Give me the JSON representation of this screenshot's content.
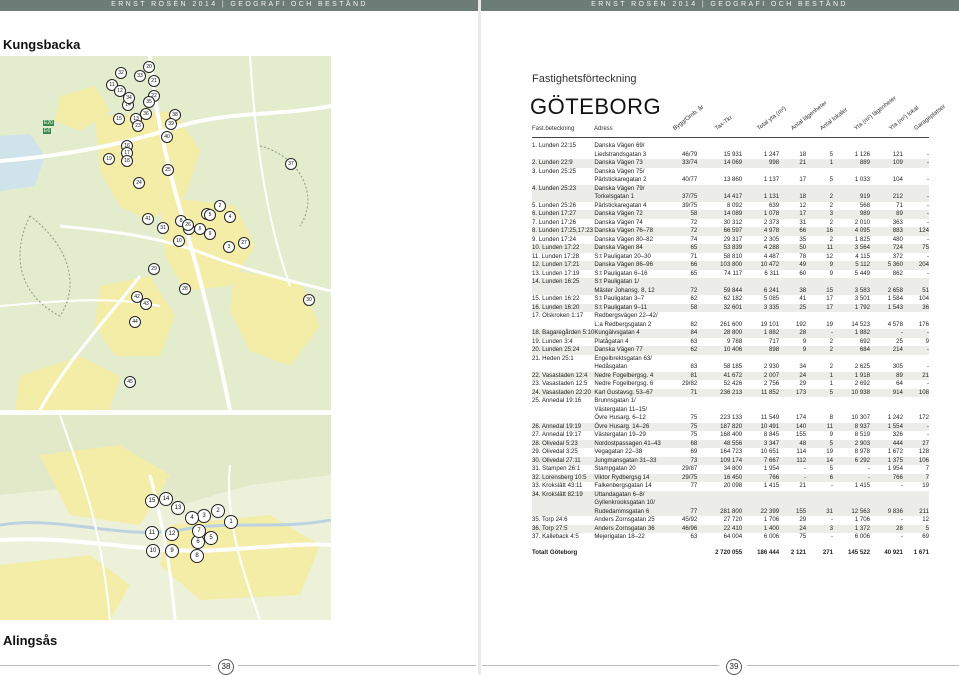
{
  "header": {
    "left": "ERNST ROSÉN 2014 | GEOGRAFI OCH BESTÅND",
    "right": "ERNST ROSÉN 2014 | GEOGRAFI OCH BESTÅND"
  },
  "sections": {
    "top": "Kungsbacka",
    "bottom": "Alingsås"
  },
  "map_top": {
    "road_label_1": "E20",
    "road_label_2": "E6",
    "markers": [
      "1",
      "2",
      "3",
      "4",
      "5",
      "6",
      "7",
      "8",
      "9",
      "10",
      "11",
      "12",
      "13",
      "14",
      "15",
      "16",
      "17",
      "18",
      "19",
      "20",
      "21",
      "22",
      "23",
      "24",
      "25",
      "26",
      "27",
      "28",
      "29",
      "30",
      "31",
      "32",
      "33",
      "34",
      "35",
      "36",
      "37",
      "38",
      "39",
      "40",
      "41",
      "42",
      "43",
      "44",
      "45"
    ]
  },
  "map_bottom": {
    "markers": [
      "1",
      "2",
      "3",
      "4",
      "5",
      "6",
      "7",
      "8",
      "9",
      "10",
      "11",
      "12",
      "13",
      "14",
      "15"
    ]
  },
  "pages": {
    "left": "38",
    "right": "39"
  },
  "document": {
    "subtitle": "Fastighetsförteckning",
    "title": "GÖTEBORG",
    "col_fastbeteckning": "Fast.beteckning",
    "col_adress": "Adress",
    "rotated_headers": [
      "Bygg/Omb. år",
      "Tax-Tkr",
      "Total yta (m²)",
      "Antal lägenheter",
      "Antal lokaler",
      "Yta (m²) lägenheter",
      "Yta (m²) lokal",
      "Garageplatser"
    ]
  },
  "rows": [
    {
      "a": "1. Lunden 22:15",
      "b": "Danska Vägen 69/",
      "c": [
        "",
        "",
        "",
        "",
        "",
        "",
        "",
        ""
      ]
    },
    {
      "a": "",
      "b": "Liedstrandsgatan 3",
      "c": [
        "46/79",
        "15 931",
        "1 247",
        "18",
        "5",
        "1 126",
        "121",
        "-"
      ]
    },
    {
      "a": "2. Lunden 22:9",
      "b": "Danska Vägen 73",
      "c": [
        "33/74",
        "14 069",
        "998",
        "21",
        "1",
        "889",
        "109",
        "-"
      ]
    },
    {
      "a": "3. Lunden 25:25",
      "b": "Danska Vägen 75/",
      "c": [
        "",
        "",
        "",
        "",
        "",
        "",
        "",
        ""
      ]
    },
    {
      "a": "",
      "b": "Pärlstickaregatan 2",
      "c": [
        "40/77",
        "13 860",
        "1 137",
        "17",
        "5",
        "1 033",
        "104",
        "-"
      ]
    },
    {
      "a": "4. Lunden 25:23",
      "b": "Danska Vägen 79/",
      "c": [
        "",
        "",
        "",
        "",
        "",
        "",
        "",
        ""
      ]
    },
    {
      "a": "",
      "b": "Torkelsgatan 1",
      "c": [
        "37/75",
        "14 417",
        "1 131",
        "18",
        "2",
        "919",
        "212",
        "-"
      ]
    },
    {
      "a": "5. Lunden 25:26",
      "b": "Pärlstickaregatan 4",
      "c": [
        "39/75",
        "8 092",
        "639",
        "12",
        "2",
        "568",
        "71",
        "-"
      ]
    },
    {
      "a": "6. Lunden 17:27",
      "b": "Danska Vägen 72",
      "c": [
        "58",
        "14 089",
        "1 078",
        "17",
        "3",
        "989",
        "89",
        "-"
      ]
    },
    {
      "a": "7. Lunden 17:26",
      "b": "Danska Vägen 74",
      "c": [
        "72",
        "30 312",
        "2 373",
        "31",
        "2",
        "2 010",
        "363",
        "-"
      ]
    },
    {
      "a": "8. Lunden 17:25,17:23",
      "b": "Danska Vägen 76–78",
      "c": [
        "72",
        "66 597",
        "4 978",
        "66",
        "16",
        "4 095",
        "883",
        "124"
      ]
    },
    {
      "a": "9. Lunden 17:24",
      "b": "Danska Vägen 80–82",
      "c": [
        "74",
        "29 317",
        "2 305",
        "35",
        "2",
        "1 825",
        "480",
        "-"
      ]
    },
    {
      "a": "10. Lunden 17:22",
      "b": "Danska Vägen 84",
      "c": [
        "65",
        "53 839",
        "4 288",
        "50",
        "11",
        "3 564",
        "724",
        "75"
      ]
    },
    {
      "a": "11. Lunden 17:28",
      "b": "S:t Pauligatan 20–30",
      "c": [
        "71",
        "58 810",
        "4 487",
        "78",
        "12",
        "4 115",
        "372",
        "-"
      ]
    },
    {
      "a": "12. Lunden 17:21",
      "b": "Danska Vägen 86–96",
      "c": [
        "66",
        "103 800",
        "10 472",
        "49",
        "9",
        "5 112",
        "5 360",
        "204"
      ]
    },
    {
      "a": "13. Lunden 17:19",
      "b": "S:t Pauligatan 6–16",
      "c": [
        "65",
        "74 117",
        "6 311",
        "60",
        "9",
        "5 449",
        "862",
        "-"
      ]
    },
    {
      "a": "14. Lunden 16:25",
      "b": "S:t Pauligatan 1/",
      "c": [
        "",
        "",
        "",
        "",
        "",
        "",
        "",
        ""
      ]
    },
    {
      "a": "",
      "b": "Mäster Johansg. 8, 12",
      "c": [
        "72",
        "59 844",
        "6 241",
        "38",
        "15",
        "3 583",
        "2 658",
        "51"
      ]
    },
    {
      "a": "15. Lunden 16:22",
      "b": "S:t Pauligatan 3–7",
      "c": [
        "62",
        "62 182",
        "5 085",
        "41",
        "17",
        "3 501",
        "1 584",
        "104"
      ]
    },
    {
      "a": "16. Lunden 16:20",
      "b": "S:t Pauligatan 9–11",
      "c": [
        "58",
        "32 601",
        "3 335",
        "25",
        "17",
        "1 792",
        "1 543",
        "36"
      ]
    },
    {
      "a": "17. Olskroken 1:17",
      "b": "Redbergsvägen 22–42/",
      "c": [
        "",
        "",
        "",
        "",
        "",
        "",
        "",
        ""
      ]
    },
    {
      "a": "",
      "b": "L:a Redbergsgatan 2",
      "c": [
        "82",
        "261 600",
        "19 101",
        "192",
        "19",
        "14 523",
        "4 578",
        "176"
      ]
    },
    {
      "a": "18. Bagaregården 5:10",
      "b": "Kungälvsgatan 4",
      "c": [
        "84",
        "28 800",
        "1 882",
        "28",
        "-",
        "1 882",
        "-",
        "-"
      ]
    },
    {
      "a": "19. Lunden 3:4",
      "b": "Platågatan 4",
      "c": [
        "63",
        "9 788",
        "717",
        "9",
        "2",
        "692",
        "25",
        "9"
      ]
    },
    {
      "a": "20. Lunden 25:24",
      "b": "Danska Vägen 77",
      "c": [
        "62",
        "10 406",
        "898",
        "9",
        "2",
        "684",
        "214",
        "-"
      ]
    },
    {
      "a": "21. Heden 25:1",
      "b": "Engelbrektsgatan 63/",
      "c": [
        "",
        "",
        "",
        "",
        "",
        "",
        "",
        ""
      ]
    },
    {
      "a": "",
      "b": "Hedåsgatan",
      "c": [
        "83",
        "58 185",
        "2 930",
        "34",
        "2",
        "2 625",
        "305",
        "-"
      ]
    },
    {
      "a": "22. Vasastaden 12:4",
      "b": "Nedre Fogelbergsg. 4",
      "c": [
        "81",
        "41 672",
        "2 007",
        "24",
        "1",
        "1 918",
        "89",
        "21"
      ]
    },
    {
      "a": "23. Vasastaden 12:5",
      "b": "Nedre Fogelbergsg. 6",
      "c": [
        "29/82",
        "52 426",
        "2 756",
        "29",
        "1",
        "2 692",
        "64",
        "-"
      ]
    },
    {
      "a": "24. Vasastaden 22:20",
      "b": "Karl Gustavsg. 53–67",
      "c": [
        "71",
        "236 213",
        "11 852",
        "173",
        "5",
        "10 938",
        "914",
        "108"
      ]
    },
    {
      "a": "25. Annedal 19:16",
      "b": "Brunnsgatan 1/",
      "c": [
        "",
        "",
        "",
        "",
        "",
        "",
        "",
        ""
      ]
    },
    {
      "a": "",
      "b": "Västergatan 11–15/",
      "c": [
        "",
        "",
        "",
        "",
        "",
        "",
        "",
        ""
      ]
    },
    {
      "a": "",
      "b": "Övre Husarg. 6–12",
      "c": [
        "75",
        "223 133",
        "11 549",
        "174",
        "8",
        "10 307",
        "1 242",
        "172"
      ]
    },
    {
      "a": "26. Annedal 19:19",
      "b": "Övre Husarg. 14–26",
      "c": [
        "75",
        "187 820",
        "10 491",
        "140",
        "11",
        "8 937",
        "1 554",
        "-"
      ]
    },
    {
      "a": "27. Annedal 19:17",
      "b": "Västergatan 19–29",
      "c": [
        "75",
        "168 400",
        "8 845",
        "155",
        "9",
        "8 519",
        "326",
        "-"
      ]
    },
    {
      "a": "28. Olivedal 5:23",
      "b": "Nordostpassagen 41–43",
      "c": [
        "68",
        "48 556",
        "3 347",
        "48",
        "5",
        "2 903",
        "444",
        "27"
      ]
    },
    {
      "a": "29. Olivedal 3:25",
      "b": "Vegagatan 22–38",
      "c": [
        "69",
        "164 723",
        "10 651",
        "114",
        "19",
        "8 978",
        "1 672",
        "128"
      ]
    },
    {
      "a": "30. Olivedal 27:11",
      "b": "Jungmansgatan 31–33",
      "c": [
        "73",
        "109 174",
        "7 667",
        "112",
        "14",
        "6 292",
        "1 375",
        "106"
      ]
    },
    {
      "a": "31. Stampen 26:1",
      "b": "Stampgatan 20",
      "c": [
        "29/87",
        "34 800",
        "1 954",
        "-",
        "5",
        "-",
        "1 954",
        "7"
      ]
    },
    {
      "a": "32. Lorensberg 10:5",
      "b": "Viktor Rydbergsg 14",
      "c": [
        "29/75",
        "16 450",
        "766",
        "-",
        "6",
        "-",
        "766",
        "7"
      ]
    },
    {
      "a": "33. Krokslätt 43:11",
      "b": "Falkenbergsgatan 14",
      "c": [
        "77",
        "20 098",
        "1 415",
        "21",
        "-",
        "1 415",
        "-",
        "19"
      ]
    },
    {
      "a": "34. Krokslätt 82:19",
      "b": "Uttandagatan 6–8/",
      "c": [
        "",
        "",
        "",
        "",
        "",
        "",
        "",
        ""
      ]
    },
    {
      "a": "",
      "b": "Gyllenkrooksgatan 10/",
      "c": [
        "",
        "",
        "",
        "",
        "",
        "",
        "",
        ""
      ]
    },
    {
      "a": "",
      "b": "Rudedammsgatan 6",
      "c": [
        "77",
        "281 800",
        "22 399",
        "155",
        "31",
        "12 563",
        "9 836",
        "211"
      ]
    },
    {
      "a": "35. Torp 24:6",
      "b": "Anders Zornsgatan 25",
      "c": [
        "45/92",
        "27 720",
        "1 706",
        "29",
        "-",
        "1 706",
        "-",
        "12"
      ]
    },
    {
      "a": "36. Torp 27:5",
      "b": "Anders Zornsgatan 36",
      "c": [
        "46/96",
        "22 410",
        "1 400",
        "24",
        "3",
        "1 372",
        "28",
        "5"
      ]
    },
    {
      "a": "37. Kalleback 4:5",
      "b": "Mejerigatan 18–22",
      "c": [
        "63",
        "64 004",
        "6 006",
        "75",
        "-",
        "6 006",
        "-",
        "69"
      ]
    }
  ],
  "total": {
    "label": "Totalt Göteborg",
    "values": [
      "",
      "2 720 055",
      "186 444",
      "2 121",
      "271",
      "145 522",
      "40 921",
      "1 671"
    ]
  },
  "colors": {
    "header_bar": "#6d7c76",
    "map_green": "#e3eccd",
    "map_yellow": "#f4eda8",
    "road": "#ffffff",
    "row_shade": "#ecece8"
  }
}
